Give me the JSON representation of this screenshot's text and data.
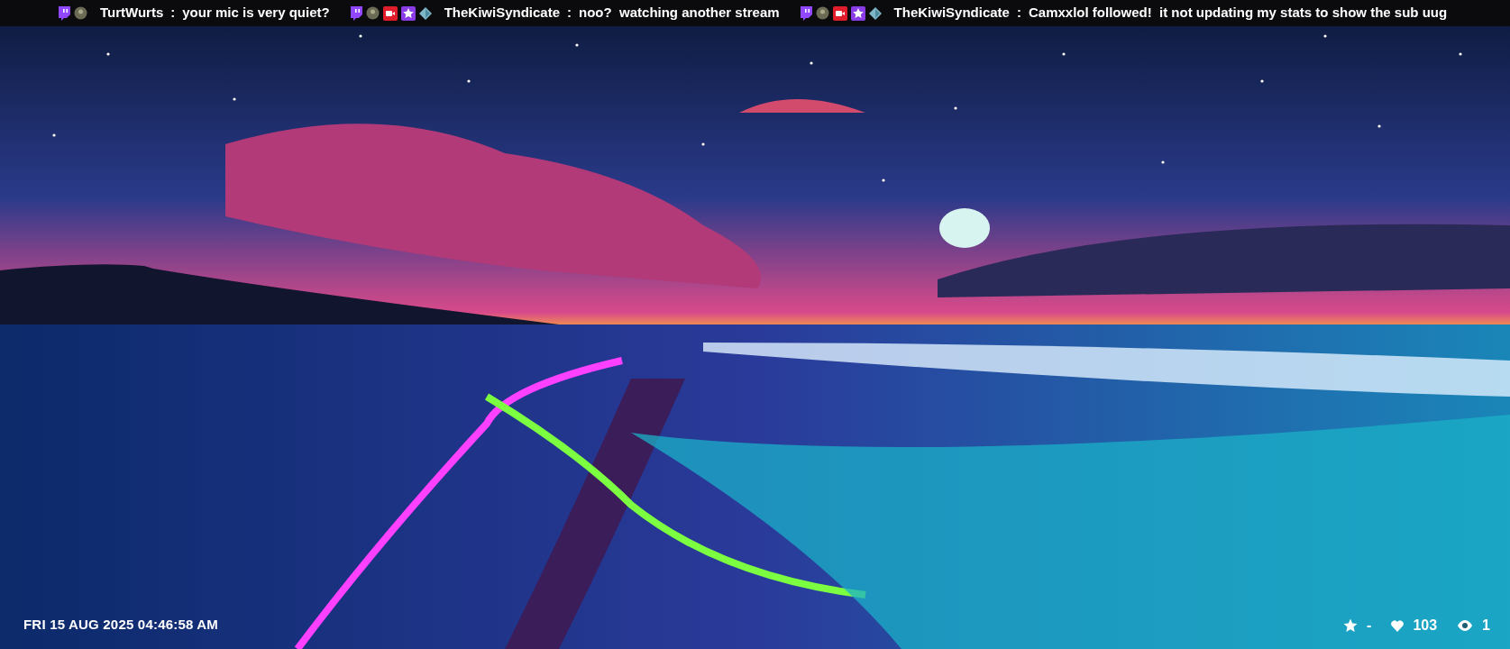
{
  "chat_ticker": [
    {
      "badges": [
        {
          "kind": "twitch"
        },
        {
          "kind": "avatar"
        }
      ],
      "user": "TurtWurts",
      "separator": ":",
      "text": "your mic is very quiet?"
    },
    {
      "badges": [
        {
          "kind": "twitch"
        },
        {
          "kind": "avatar"
        },
        {
          "kind": "camera"
        },
        {
          "kind": "star"
        },
        {
          "kind": "gem"
        }
      ],
      "user": "TheKiwiSyndicate",
      "separator": ":",
      "text": "noo?  watching another stream"
    },
    {
      "badges": [
        {
          "kind": "twitch"
        },
        {
          "kind": "avatar"
        },
        {
          "kind": "camera"
        },
        {
          "kind": "star"
        },
        {
          "kind": "gem"
        }
      ],
      "user": "TheKiwiSyndicate",
      "separator": ":",
      "text": "Camxxlol followed!  it not updating my stats to show the sub uug"
    }
  ],
  "clock": "FRI 15 AUG 2025 04:46:58 AM",
  "stats": [
    {
      "kind": "star",
      "value": "-"
    },
    {
      "kind": "heart",
      "value": "103"
    },
    {
      "kind": "viewers",
      "value": "1"
    }
  ]
}
